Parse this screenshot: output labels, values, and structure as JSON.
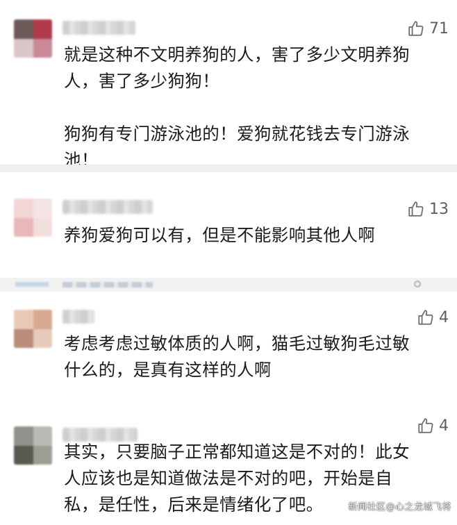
{
  "comments": [
    {
      "likes": "71",
      "text": "就是这种不文明养狗的人，害了多少文明养狗\n人，害了多少狗狗！\n\n狗狗有专门游泳池的！爱狗就花钱去专门游泳\n池！"
    },
    {
      "likes": "13",
      "text": "养狗爱狗可以有，但是不能影响其他人啊"
    },
    {
      "likes": "4",
      "text": "考虑考虑过敏体质的人啊，猫毛过敏狗毛过敏\n什么的，是真有这样的人啊"
    },
    {
      "likes": "4",
      "text": "其实，只要脑子正常都知道这是不对的！此女\n人应该也是知道做法是不对的吧，开始是自\n私，是任性，后来是情绪化了吧。"
    }
  ],
  "watermark": "新闻社区@心之龙城飞将",
  "icons": {
    "like": "thumbs-up-icon"
  },
  "colors": {
    "text": "#1b1b1b",
    "like": "#666666",
    "divider": "#efefef"
  }
}
